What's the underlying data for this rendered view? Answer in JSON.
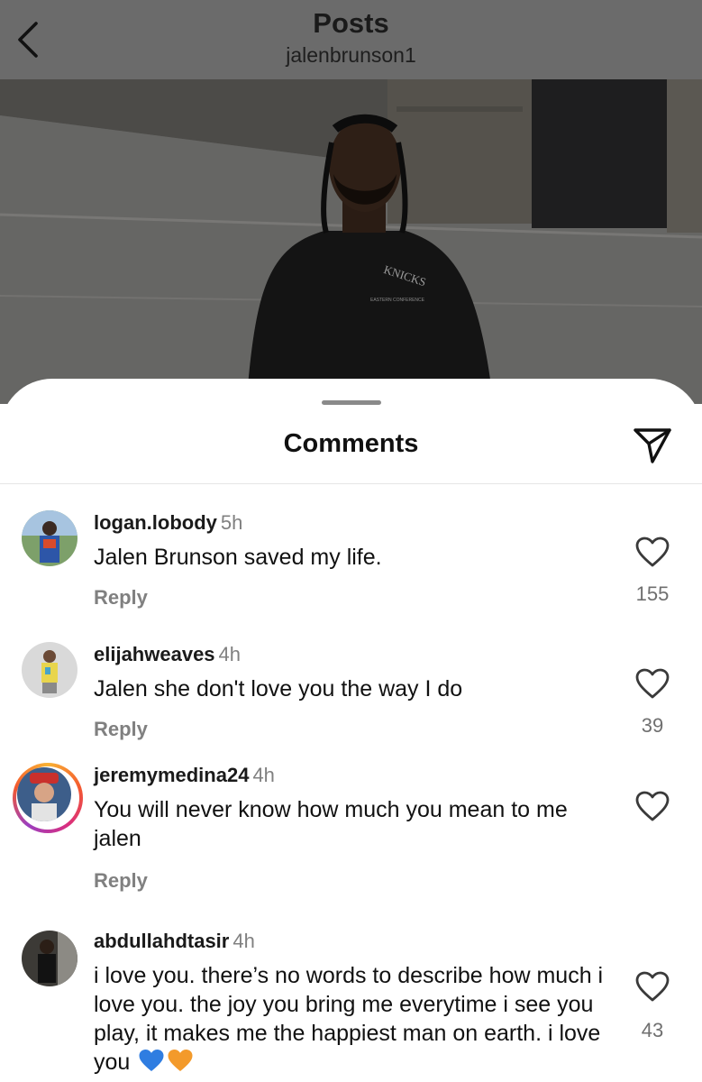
{
  "header": {
    "title": "Posts",
    "subtitle": "jalenbrunson1",
    "back_icon": "chevron-left-icon"
  },
  "photo": {
    "shirt_text_top": "KNICKS",
    "shirt_text_sub": "EASTERN CONFERENCE"
  },
  "sheet": {
    "title": "Comments",
    "share_icon": "send-icon"
  },
  "comments": [
    {
      "username": "logan.lobody",
      "time": "5h",
      "text": "Jalen Brunson saved my life.",
      "reply": "Reply",
      "likes": "155"
    },
    {
      "username": "elijahweaves",
      "time": "4h",
      "text": "Jalen she don't love you the way I do",
      "reply": "Reply",
      "likes": "39"
    },
    {
      "username": "jeremymedina24",
      "time": "4h",
      "text": "You will never know how much you mean to me jalen",
      "reply": "Reply",
      "likes": ""
    },
    {
      "username": "abdullahdtasir",
      "time": "4h",
      "text": "i love you. there’s no words to describe how much i love you. the joy you bring me everytime i see you play, it makes me the happiest man on earth. i love you",
      "emojis": [
        "blue-heart-icon",
        "orange-heart-icon"
      ],
      "likes": "43"
    }
  ],
  "colors": {
    "header_bg": "#6b6b6b",
    "muted_text": "#808080",
    "blue_heart": "#2f7de1",
    "orange_heart": "#f39a2b"
  }
}
